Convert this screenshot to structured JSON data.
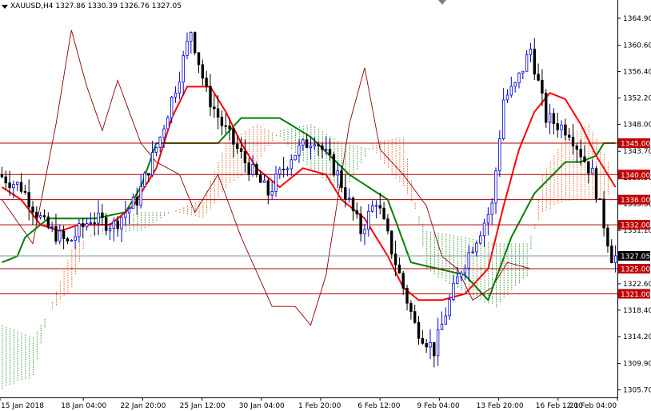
{
  "title_bar": {
    "symbol": "XAUUSD,H4",
    "ohlc": "1327.86 1330.39 1326.76 1327.05"
  },
  "colors": {
    "background": "#ffffff",
    "bull": "#0000cc",
    "bear": "#000000",
    "tenkan": "#ff0000",
    "kijun": "#008000",
    "chikou": "#8b0000",
    "cloud_bull": "#228b22",
    "cloud_bear": "#e85010",
    "level_line": "#b00000",
    "level_label_bg": "#c00000",
    "current_label_bg": "#000000"
  },
  "chart_data": {
    "type": "candlestick",
    "indicator": "Ichimoku Kinko Hyo",
    "ylim": [
      1304.5,
      1367.8
    ],
    "y_ticks": [
      "1364.90",
      "1360.60",
      "1356.40",
      "1352.20",
      "1348.00",
      "1343.70",
      "1339.50",
      "1335.30",
      "1331.10",
      "1322.60",
      "1318.40",
      "1314.20",
      "1309.90",
      "1305.70"
    ],
    "x_ticks": [
      "15 Jan 2018",
      "18 Jan 04:00",
      "22 Jan 20:00",
      "25 Jan 12:00",
      "30 Jan 04:00",
      "1 Feb 20:00",
      "6 Feb 12:00",
      "9 Feb 04:00",
      "13 Feb 20:00",
      "16 Feb 12:00",
      "21 Feb 04:00"
    ],
    "levels": [
      "1345.00",
      "1340.00",
      "1336.00",
      "1332.00",
      "1325.00",
      "1321.00"
    ],
    "current_price": "1327.05"
  }
}
